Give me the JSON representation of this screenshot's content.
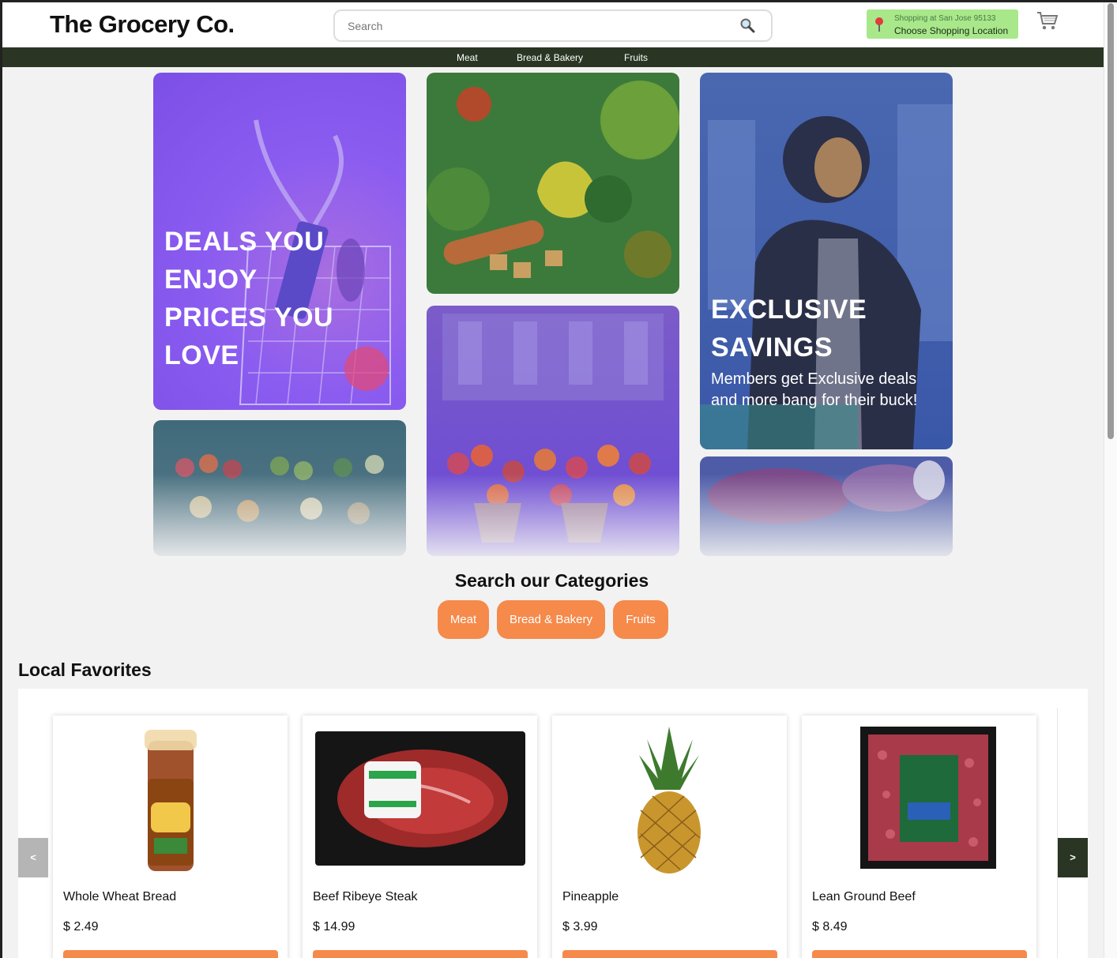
{
  "header": {
    "logo": "The Grocery Co.",
    "search_placeholder": "Search",
    "location_small": "Shopping at San Jose 95133",
    "location_big": "Choose Shopping Location"
  },
  "nav": {
    "items": [
      "Meat",
      "Bread & Bakery",
      "Fruits"
    ]
  },
  "hero": {
    "deals_text": "DEALS YOU ENJOY PRICES YOU LOVE",
    "deals_lines": [
      "DEALS YOU",
      "ENJOY",
      "PRICES YOU",
      "LOVE"
    ],
    "exclusive_lines": [
      "EXCLUSIVE",
      "SAVINGS"
    ],
    "exclusive_sub_lines": [
      "Members get Exclusive deals",
      "and more bang for their buck!"
    ]
  },
  "categories": {
    "title": "Search our Categories",
    "buttons": [
      "Meat",
      "Bread & Bakery",
      "Fruits"
    ]
  },
  "local_favorites": {
    "title": "Local Favorites",
    "prev_label": "<",
    "next_label": ">",
    "products": [
      {
        "name": "Whole Wheat Bread",
        "price": "$ 2.49"
      },
      {
        "name": "Beef Ribeye Steak",
        "price": "$ 14.99"
      },
      {
        "name": "Pineapple",
        "price": "$ 3.99"
      },
      {
        "name": "Lean Ground Beef",
        "price": "$ 8.49"
      }
    ]
  },
  "icons": {
    "search": "search-icon",
    "location": "location-pin-icon",
    "cart": "cart-icon"
  },
  "colors": {
    "nav_bg": "#2a3523",
    "location_bg": "#a8e88a",
    "accent_orange": "#f58a4b",
    "hero_purple": "#8a5ae0"
  }
}
